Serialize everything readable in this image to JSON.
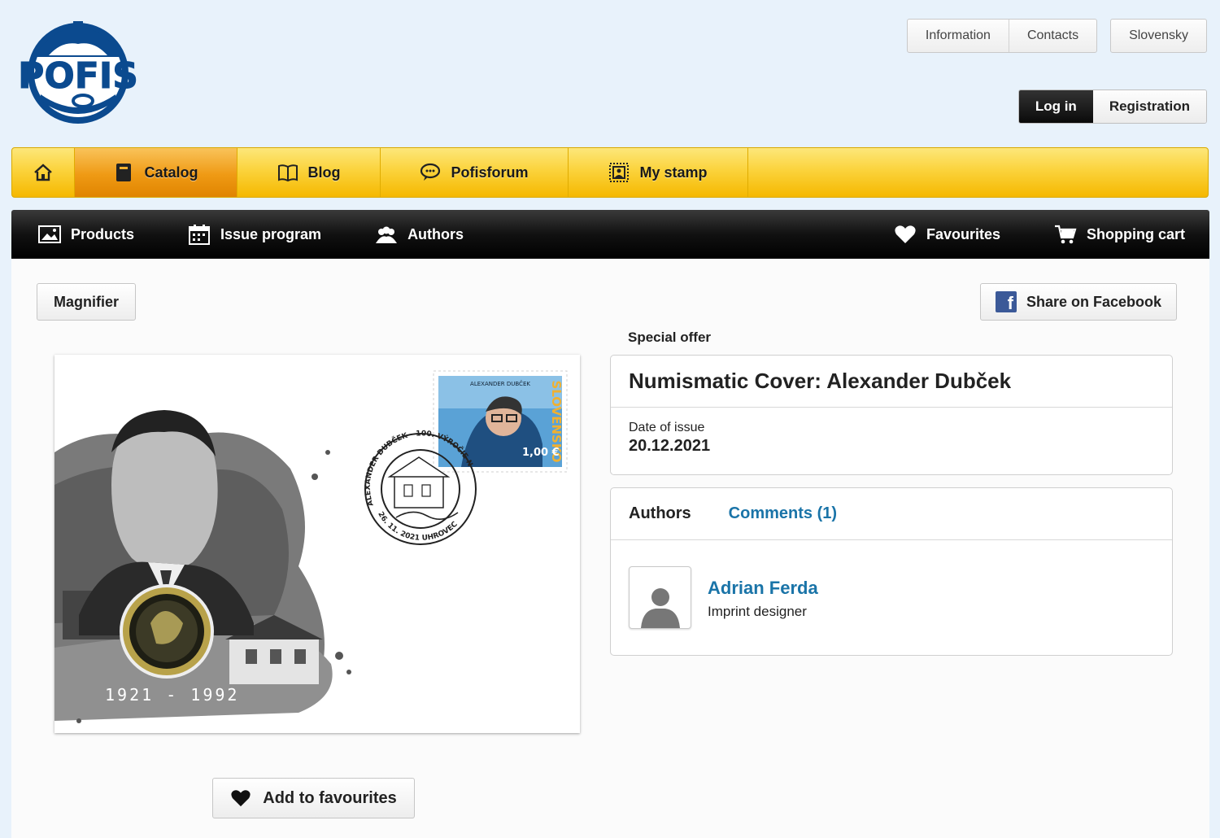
{
  "header": {
    "logo_text": "POFIS",
    "top_links": [
      "Information",
      "Contacts"
    ],
    "language": "Slovensky",
    "login_label": "Log in",
    "register_label": "Registration"
  },
  "main_nav": {
    "catalog": "Catalog",
    "blog": "Blog",
    "forum": "Pofisforum",
    "mystamp": "My stamp"
  },
  "sub_nav": {
    "products": "Products",
    "issue_program": "Issue program",
    "authors": "Authors",
    "favourites": "Favourites",
    "cart": "Shopping cart"
  },
  "product": {
    "magnifier_label": "Magnifier",
    "share_label": "Share on Facebook",
    "special_offer": "Special offer",
    "title": "Numismatic Cover: Alexander Dubček",
    "date_label": "Date of issue",
    "date_value": "20.12.2021",
    "add_fav_label": "Add to favourites",
    "cover_years": "1921 - 1992",
    "stamp_country": "SLOVENSKO",
    "stamp_value": "1,00 €",
    "stamp_name": "ALEXANDER DUBČEK",
    "postmark_text": "ALEXANDER DUBČEK - 100. VÝROČIE NARODENIA",
    "postmark_date": "26. 11. 2021 UHROVEC"
  },
  "tabs": {
    "authors": "Authors",
    "comments": "Comments (1)"
  },
  "authors": [
    {
      "name": "Adrian Ferda",
      "role": "Imprint designer"
    }
  ],
  "colors": {
    "brand_blue": "#0b4a8f",
    "nav_yellow": "#fbd33c",
    "nav_active": "#ef9a14",
    "link_blue": "#1a74a8"
  }
}
